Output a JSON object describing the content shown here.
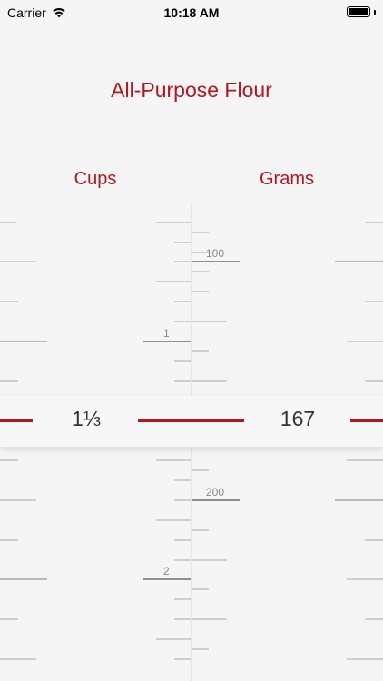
{
  "status_bar": {
    "carrier": "Carrier",
    "time": "10:18 AM",
    "icons": [
      "wifi-icon",
      "battery-icon"
    ]
  },
  "screen": {
    "title": "All-Purpose Flour",
    "columns": {
      "left": "Cups",
      "right": "Grams"
    },
    "readout": {
      "cups": "1⅓",
      "grams": "167"
    }
  },
  "ruler": {
    "cups_labels": [
      "1",
      "2"
    ],
    "grams_labels": [
      "100",
      "200"
    ]
  },
  "colors": {
    "accent": "#b2161f",
    "background": "#f5f5f5"
  }
}
